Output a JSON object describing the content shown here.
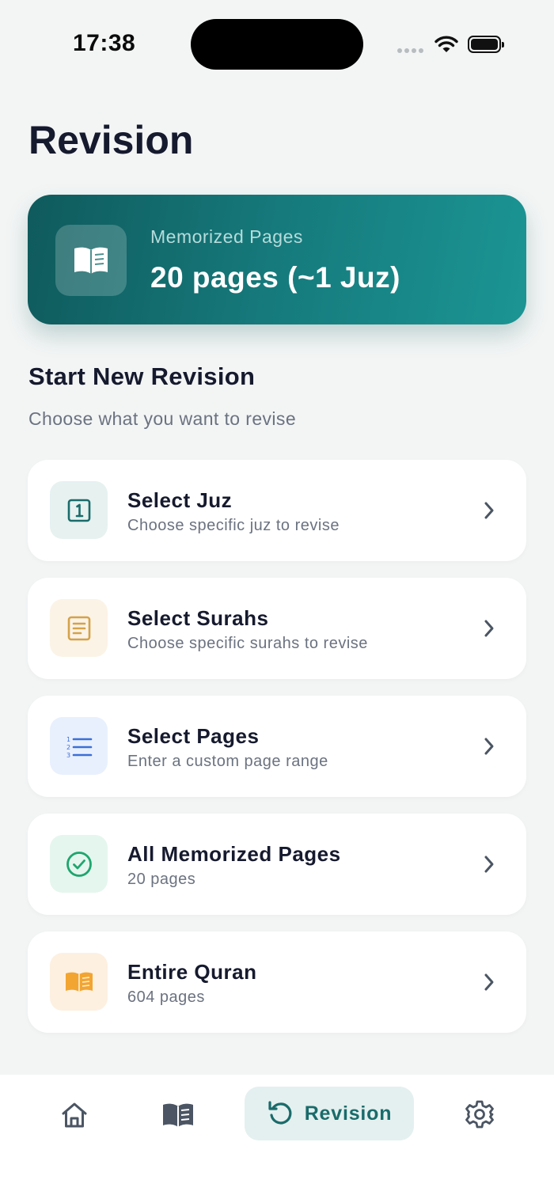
{
  "status_bar": {
    "time": "17:38"
  },
  "page": {
    "title": "Revision"
  },
  "hero": {
    "label": "Memorized Pages",
    "value": "20 pages (~1 Juz)"
  },
  "section": {
    "title": "Start New Revision",
    "subtitle": "Choose what you want to revise"
  },
  "options": [
    {
      "title": "Select Juz",
      "subtitle": "Choose specific juz to revise",
      "icon": "juz-number-icon",
      "icon_color": "#1a6b6b",
      "icon_bg": "#e6f1f0"
    },
    {
      "title": "Select Surahs",
      "subtitle": "Choose specific surahs to revise",
      "icon": "document-icon",
      "icon_color": "#d4a24a",
      "icon_bg": "#fbf3e6"
    },
    {
      "title": "Select Pages",
      "subtitle": "Enter a custom page range",
      "icon": "numbered-list-icon",
      "icon_color": "#3b6fd8",
      "icon_bg": "#e9f0fd"
    },
    {
      "title": "All Memorized Pages",
      "subtitle": "20 pages",
      "icon": "check-circle-icon",
      "icon_color": "#1ea66e",
      "icon_bg": "#e5f6ee"
    },
    {
      "title": "Entire Quran",
      "subtitle": "604 pages",
      "icon": "open-book-icon",
      "icon_color": "#f2a531",
      "icon_bg": "#fdf0e0"
    }
  ],
  "tab_bar": {
    "items": [
      {
        "name": "home",
        "icon": "home-icon"
      },
      {
        "name": "read",
        "icon": "book-icon"
      },
      {
        "name": "revision",
        "icon": "refresh-icon",
        "label": "Revision",
        "active": true
      },
      {
        "name": "settings",
        "icon": "gear-icon"
      }
    ]
  },
  "colors": {
    "accent": "#1a6b6b",
    "background": "#f3f5f5",
    "text": "#161a2e",
    "muted": "#6b7280"
  }
}
